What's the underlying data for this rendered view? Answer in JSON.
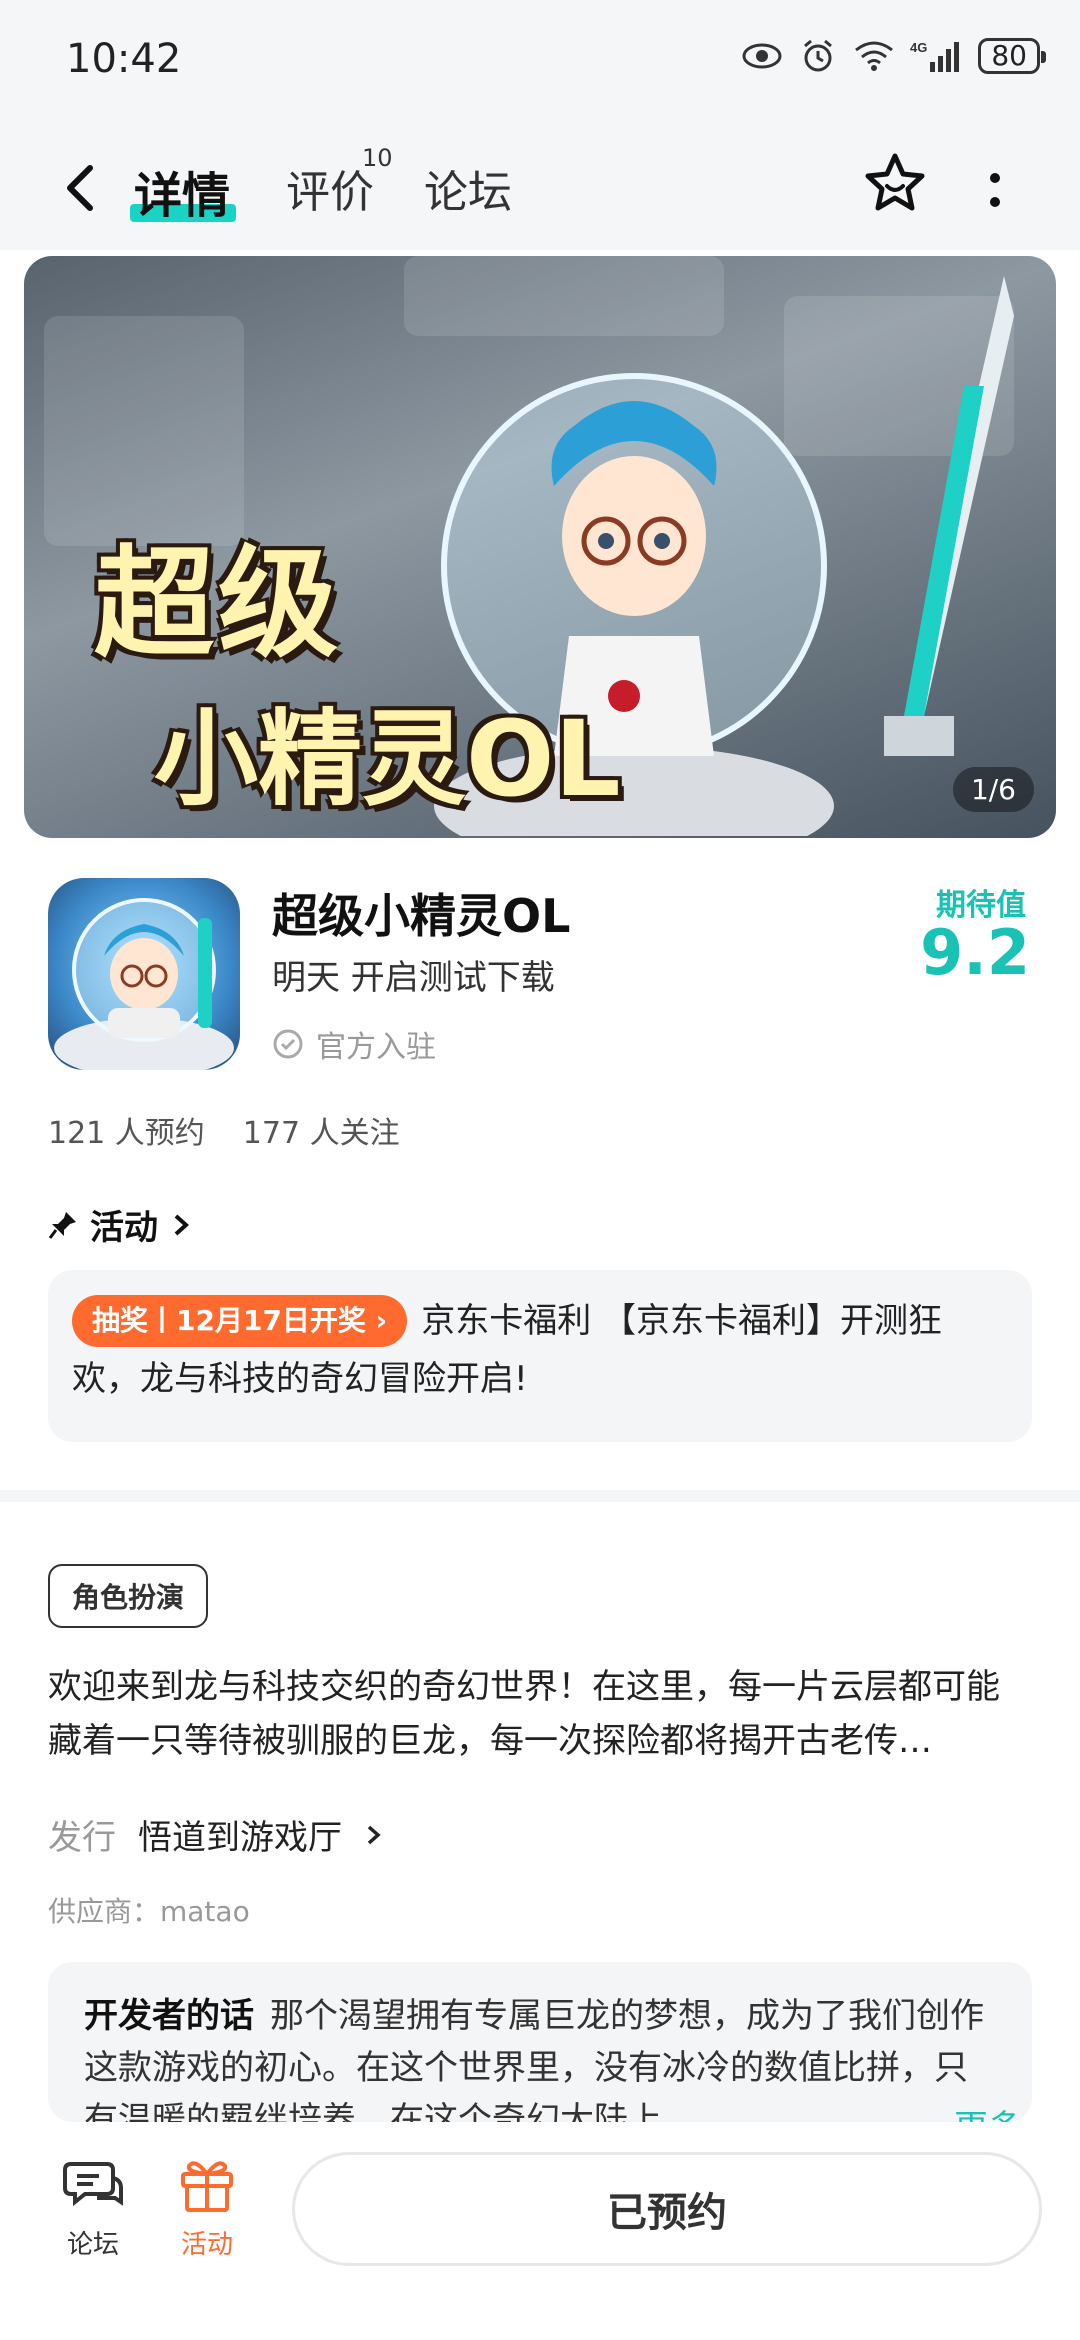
{
  "status_bar": {
    "time": "10:42",
    "network_label": "4G",
    "battery": "80",
    "icons": [
      "eye-icon",
      "alarm-icon",
      "wifi-icon",
      "signal-icon",
      "battery-icon"
    ]
  },
  "nav": {
    "tabs": [
      {
        "label": "详情",
        "active": true
      },
      {
        "label": "评价",
        "badge": "10"
      },
      {
        "label": "论坛"
      }
    ]
  },
  "banner": {
    "title_line1": "超级",
    "title_line2": "小精灵OL",
    "counter": "1/6"
  },
  "app": {
    "name": "超级小精灵OL",
    "subtitle": "明天 开启测试下载",
    "official": "官方入驻",
    "expectation_label": "期待值",
    "expectation_value": "9.2"
  },
  "stats": {
    "reservations": "121 人预约",
    "followers": "177 人关注"
  },
  "activity": {
    "heading": "活动",
    "tag": "抽奖丨12月17日开奖",
    "text": "京东卡福利 【京东卡福利】开测狂欢，龙与科技的奇幻冒险开启!"
  },
  "info": {
    "genre": "角色扮演",
    "description": "欢迎来到龙与科技交织的奇幻世界！在这里，每一片云层都可能藏着一只等待被驯服的巨龙，每一次探险都将揭开古老传…",
    "publisher_label": "发行",
    "publisher": "悟道到游戏厅",
    "supplier": "供应商：matao"
  },
  "developer": {
    "title": "开发者的话",
    "text": "那个渴望拥有专属巨龙的梦想，成为了我们创作这款游戏的初心。在这个世界里，没有冰冷的数值比拼，只有温暖的羁绊培养。在这个奇幻大陆上，",
    "more": "更多"
  },
  "bottom": {
    "forum": "论坛",
    "activity": "活动",
    "reserve": "已预约"
  },
  "colors": {
    "accent": "#19c2b4",
    "orange": "#ff6a2f"
  }
}
